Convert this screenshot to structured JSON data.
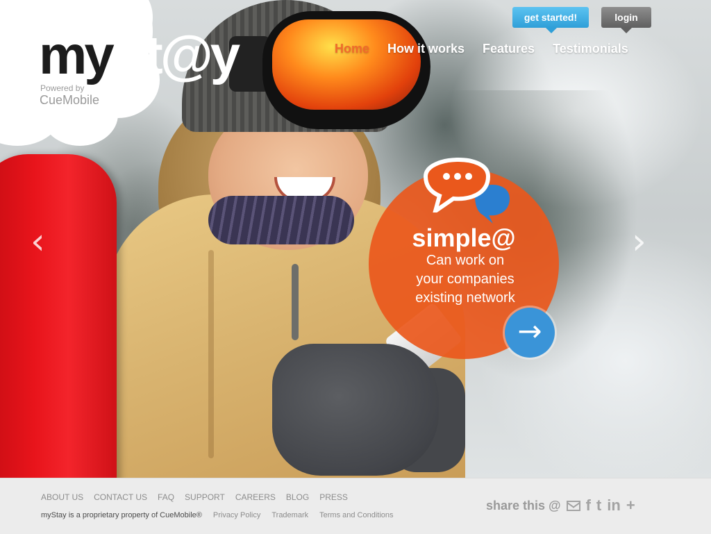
{
  "header": {
    "logo_text": "mySt@y",
    "logo_my": "my",
    "logo_stay": "St@y",
    "powered_by": "Powered by",
    "powered_company": "CueMobile",
    "get_started_label": "get started!",
    "login_label": "login"
  },
  "nav": {
    "items": [
      {
        "label": "Home",
        "active": true
      },
      {
        "label": "How it works",
        "active": false
      },
      {
        "label": "Features",
        "active": false
      },
      {
        "label": "Testimonials",
        "active": false
      }
    ]
  },
  "hero": {
    "prev_arrow": "‹",
    "next_arrow": "›",
    "callout_title": "simple@",
    "callout_text": "Can work on\nyour companies\nexisting network",
    "go_arrow": "→",
    "accent_orange": "#ea581c",
    "accent_blue": "#3a94d8"
  },
  "footer": {
    "links": [
      "ABOUT US",
      "CONTACT US",
      "FAQ",
      "SUPPORT",
      "CAREERS",
      "BLOG",
      "PRESS"
    ],
    "copyright": "myStay is a proprietary property of CueMobile®",
    "legal_links": [
      "Privacy Policy",
      "Trademark",
      "Terms and Conditions"
    ],
    "share_label": "share this @",
    "share_icons": [
      "mail-icon",
      "facebook-icon",
      "twitter-icon",
      "linkedin-icon",
      "plus-icon"
    ],
    "share_glyphs": {
      "facebook": "f",
      "twitter": "t",
      "linkedin": "in",
      "plus": "+"
    }
  }
}
